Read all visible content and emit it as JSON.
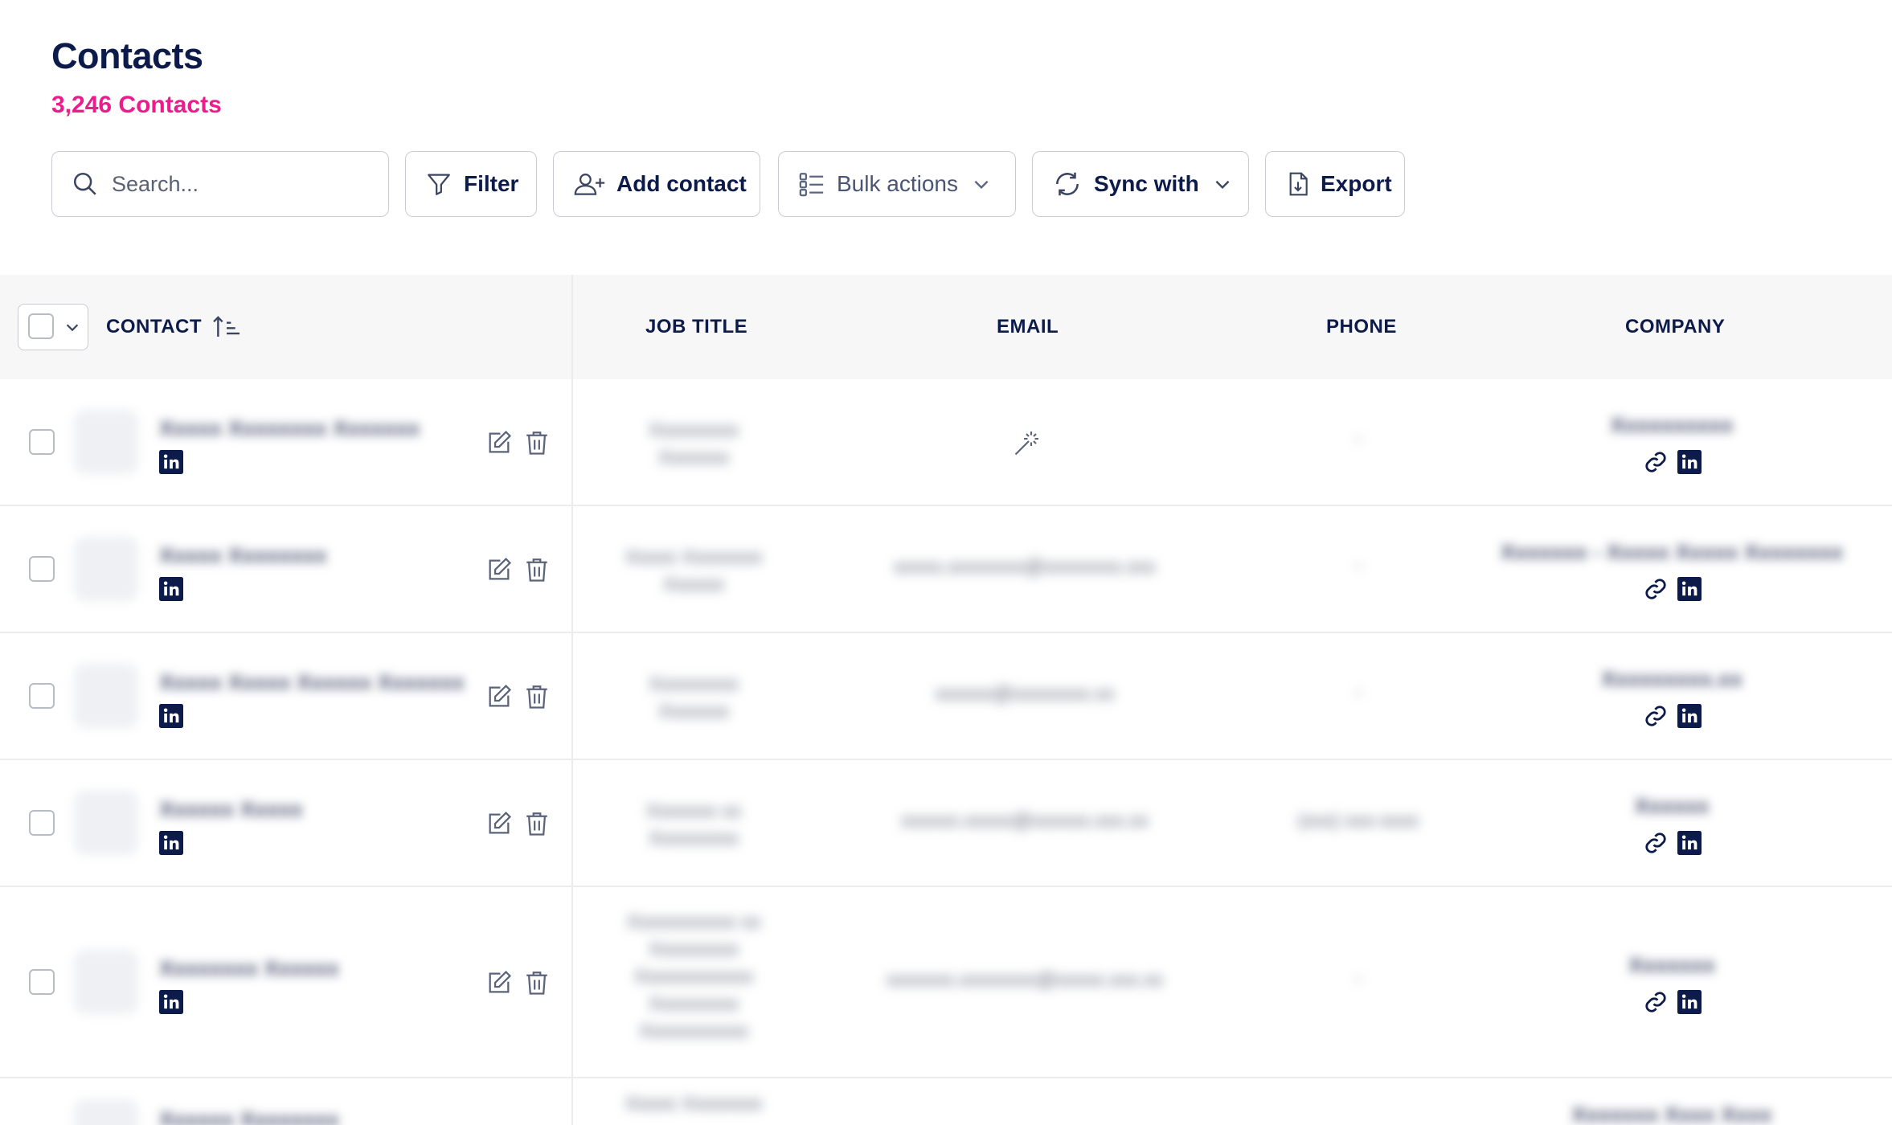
{
  "header": {
    "title": "Contacts",
    "count_label": "3,246 Contacts"
  },
  "toolbar": {
    "search_placeholder": "Search...",
    "filter_label": "Filter",
    "add_contact_label": "Add contact",
    "bulk_actions_label": "Bulk actions",
    "sync_with_label": "Sync with",
    "export_label": "Export"
  },
  "table": {
    "columns": {
      "contact": "CONTACT",
      "job_title": "JOB TITLE",
      "email": "EMAIL",
      "phone": "PHONE",
      "company": "COMPANY"
    },
    "rows": [
      {
        "name": "Xxxxx Xxxxxxxx Xxxxxxx",
        "job_line1": "Xxxxxxxxx",
        "job_line2": "Xxxxxxx",
        "email": "",
        "phone": "-",
        "company": "Xxxxxxxxxx"
      },
      {
        "name": "Xxxxx Xxxxxxxx",
        "job_line1": "Xxxxx Xxxxxxxx",
        "job_line2": "Xxxxxx",
        "email": "xxxxx.xxxxxxxx@xxxxxxxx.xxx",
        "phone": "-",
        "company": "Xxxxxxx - Xxxxx Xxxxx Xxxxxxxx"
      },
      {
        "name": "Xxxxx Xxxxx Xxxxxx Xxxxxxx",
        "job_line1": "Xxxxxxxxx",
        "job_line2": "Xxxxxxx",
        "email": "xxxxxx@xxxxxxxx.xx",
        "phone": "-",
        "company": "Xxxxxxxxx.xx"
      },
      {
        "name": "Xxxxxx Xxxxx",
        "job_line1": "Xxxxxxx xx",
        "job_line2": "Xxxxxxxxx",
        "email": "xxxxxx.xxxxx@xxxxxx.xxx.xx",
        "phone": "(xxx) xxx-xxxx",
        "company": "Xxxxxx"
      },
      {
        "name": "Xxxxxxxx Xxxxxx",
        "job_line1": "Xxxxxxxxxxx xx",
        "job_line2": "Xxxxxxxxx",
        "job_line3": "Xxxxxxxxxxxx",
        "job_line4": "Xxxxxxxxx",
        "job_line5": "Xxxxxxxxxxx",
        "email": "xxxxxxx.xxxxxxxx@xxxxx.xxx.xx",
        "phone": "-",
        "company": "Xxxxxxx"
      },
      {
        "name": "Xxxxxx Xxxxxxxx",
        "job_line1": "Xxxxx Xxxxxxxx",
        "job_line2": "",
        "email": "",
        "phone": "",
        "company": "Xxxxxxx Xxxx Xxxx"
      }
    ]
  },
  "colors": {
    "title": "#0d1b4b",
    "count": "#ec1c8c",
    "header_bg": "#f7f7f8",
    "linkedin": "#0d1b4b"
  }
}
